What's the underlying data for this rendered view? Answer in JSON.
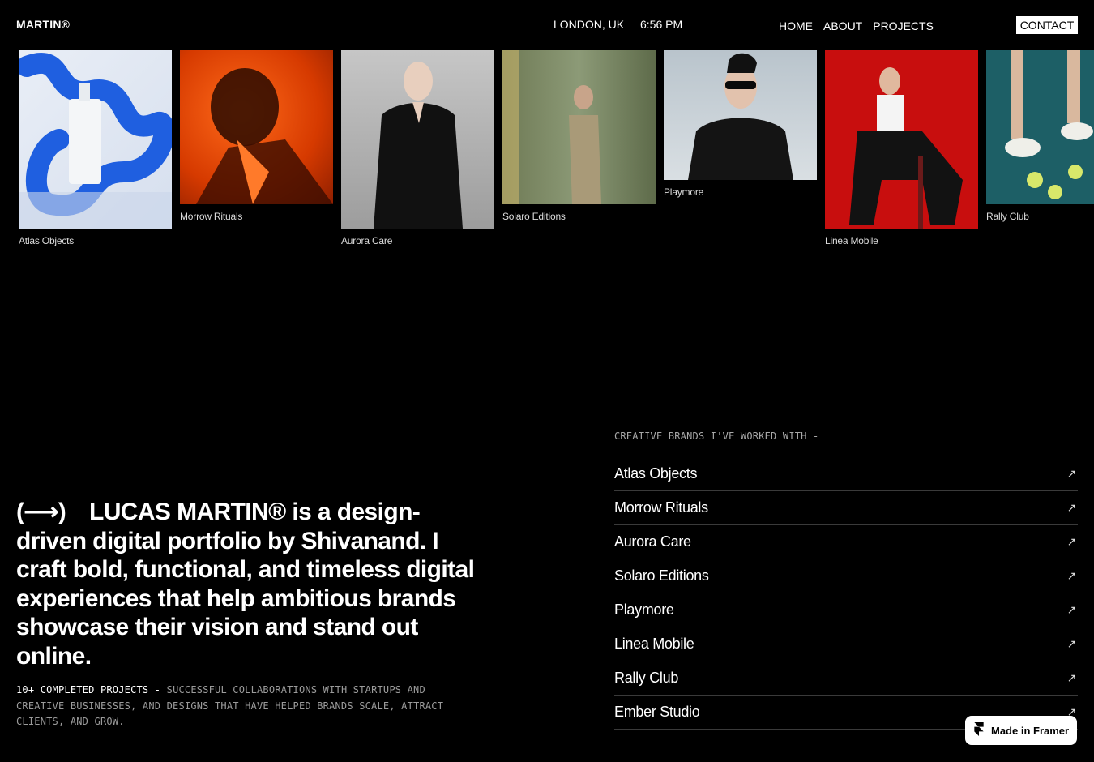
{
  "header": {
    "logo": "MARTIN®",
    "location": "LONDON, UK",
    "time": "6:56 PM",
    "nav": [
      "HOME",
      "ABOUT",
      "PROJECTS"
    ],
    "contact": "CONTACT"
  },
  "gallery": [
    {
      "label": "Atlas Objects",
      "color": "#1f5fe0"
    },
    {
      "label": "Morrow Rituals",
      "color": "#ff5a0a"
    },
    {
      "label": "Aurora Care",
      "color": "#a8a8a8"
    },
    {
      "label": "Solaro Editions",
      "color": "#7d8a62"
    },
    {
      "label": "Playmore",
      "color": "#c9d2d8"
    },
    {
      "label": "Linea Mobile",
      "color": "#c80e0e"
    },
    {
      "label": "Rally Club",
      "color": "#1d5f66"
    }
  ],
  "intro": {
    "arrow": "(⟶)",
    "text": "LUCAS MARTIN® is a design-driven digital portfolio by Shivanand. I craft bold, functional, and timeless digital experiences that help ambitious brands showcase their vision and stand out online."
  },
  "stats": {
    "highlight": "10+ COMPLETED PROJECTS -",
    "rest": "SUCCESSFUL COLLABORATIONS WITH STARTUPS AND CREATIVE BUSINESSES, AND DESIGNS THAT HAVE HELPED BRANDS SCALE, ATTRACT CLIENTS, AND GROW."
  },
  "brands": {
    "heading": "CREATIVE BRANDS I'VE WORKED WITH -",
    "items": [
      "Atlas Objects",
      "Morrow Rituals",
      "Aurora Care",
      "Solaro Editions",
      "Playmore",
      "Linea Mobile",
      "Rally Club",
      "Ember Studio"
    ],
    "arrow": "↗"
  },
  "badge": {
    "label": "Made in Framer",
    "icon": "framer-logo-icon"
  }
}
